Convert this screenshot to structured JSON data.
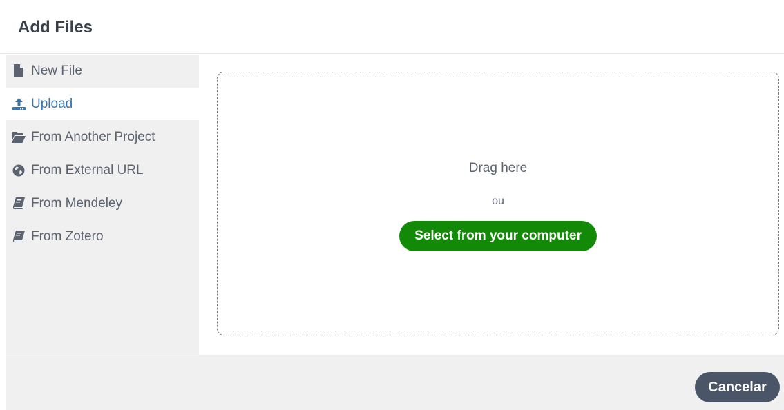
{
  "dialog": {
    "title": "Add Files"
  },
  "sidebar": {
    "items": [
      {
        "label": "New File",
        "icon": "file-icon",
        "active": false
      },
      {
        "label": "Upload",
        "icon": "upload-icon",
        "active": true
      },
      {
        "label": "From Another Project",
        "icon": "folder-open-icon",
        "active": false
      },
      {
        "label": "From External URL",
        "icon": "globe-icon",
        "active": false
      },
      {
        "label": "From Mendeley",
        "icon": "book-icon",
        "active": false
      },
      {
        "label": "From Zotero",
        "icon": "book-icon",
        "active": false
      }
    ]
  },
  "dropzone": {
    "drag_text": "Drag here",
    "or_text": "ou",
    "select_label": "Select from your computer"
  },
  "footer": {
    "cancel_label": "Cancelar"
  },
  "colors": {
    "active_item": "#3a74a8",
    "primary_green": "#138a07",
    "cancel_bg": "#4a5568",
    "sidebar_bg": "#f0f0f0",
    "text_gray": "#5c6370"
  }
}
